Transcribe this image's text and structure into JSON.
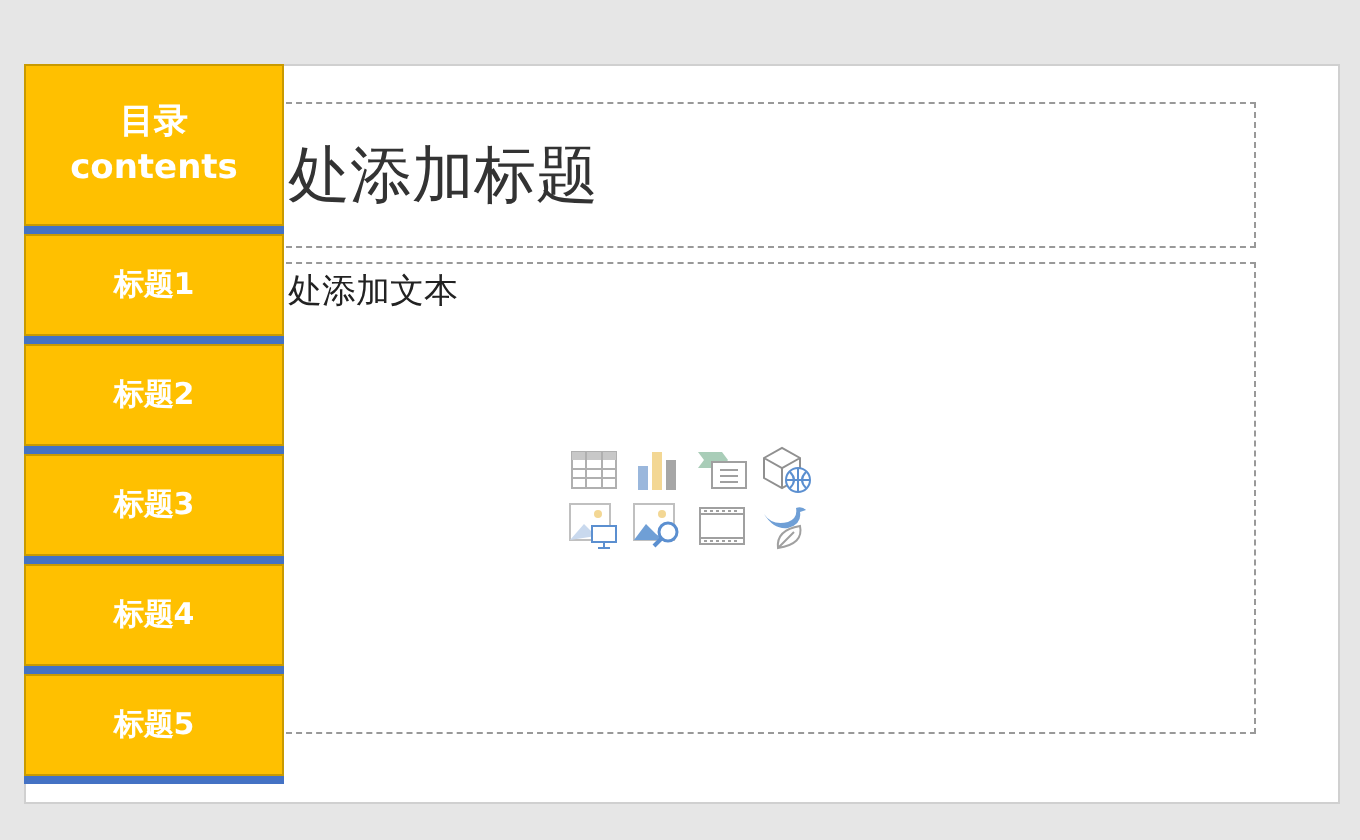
{
  "slide": {
    "title_placeholder": "处添加标题",
    "body_placeholder": "处添加文本",
    "contents_panel": {
      "header": [
        "目录",
        "contents"
      ],
      "items": [
        "标题1",
        "标题2",
        "标题3",
        "标题4",
        "标题5"
      ]
    }
  }
}
